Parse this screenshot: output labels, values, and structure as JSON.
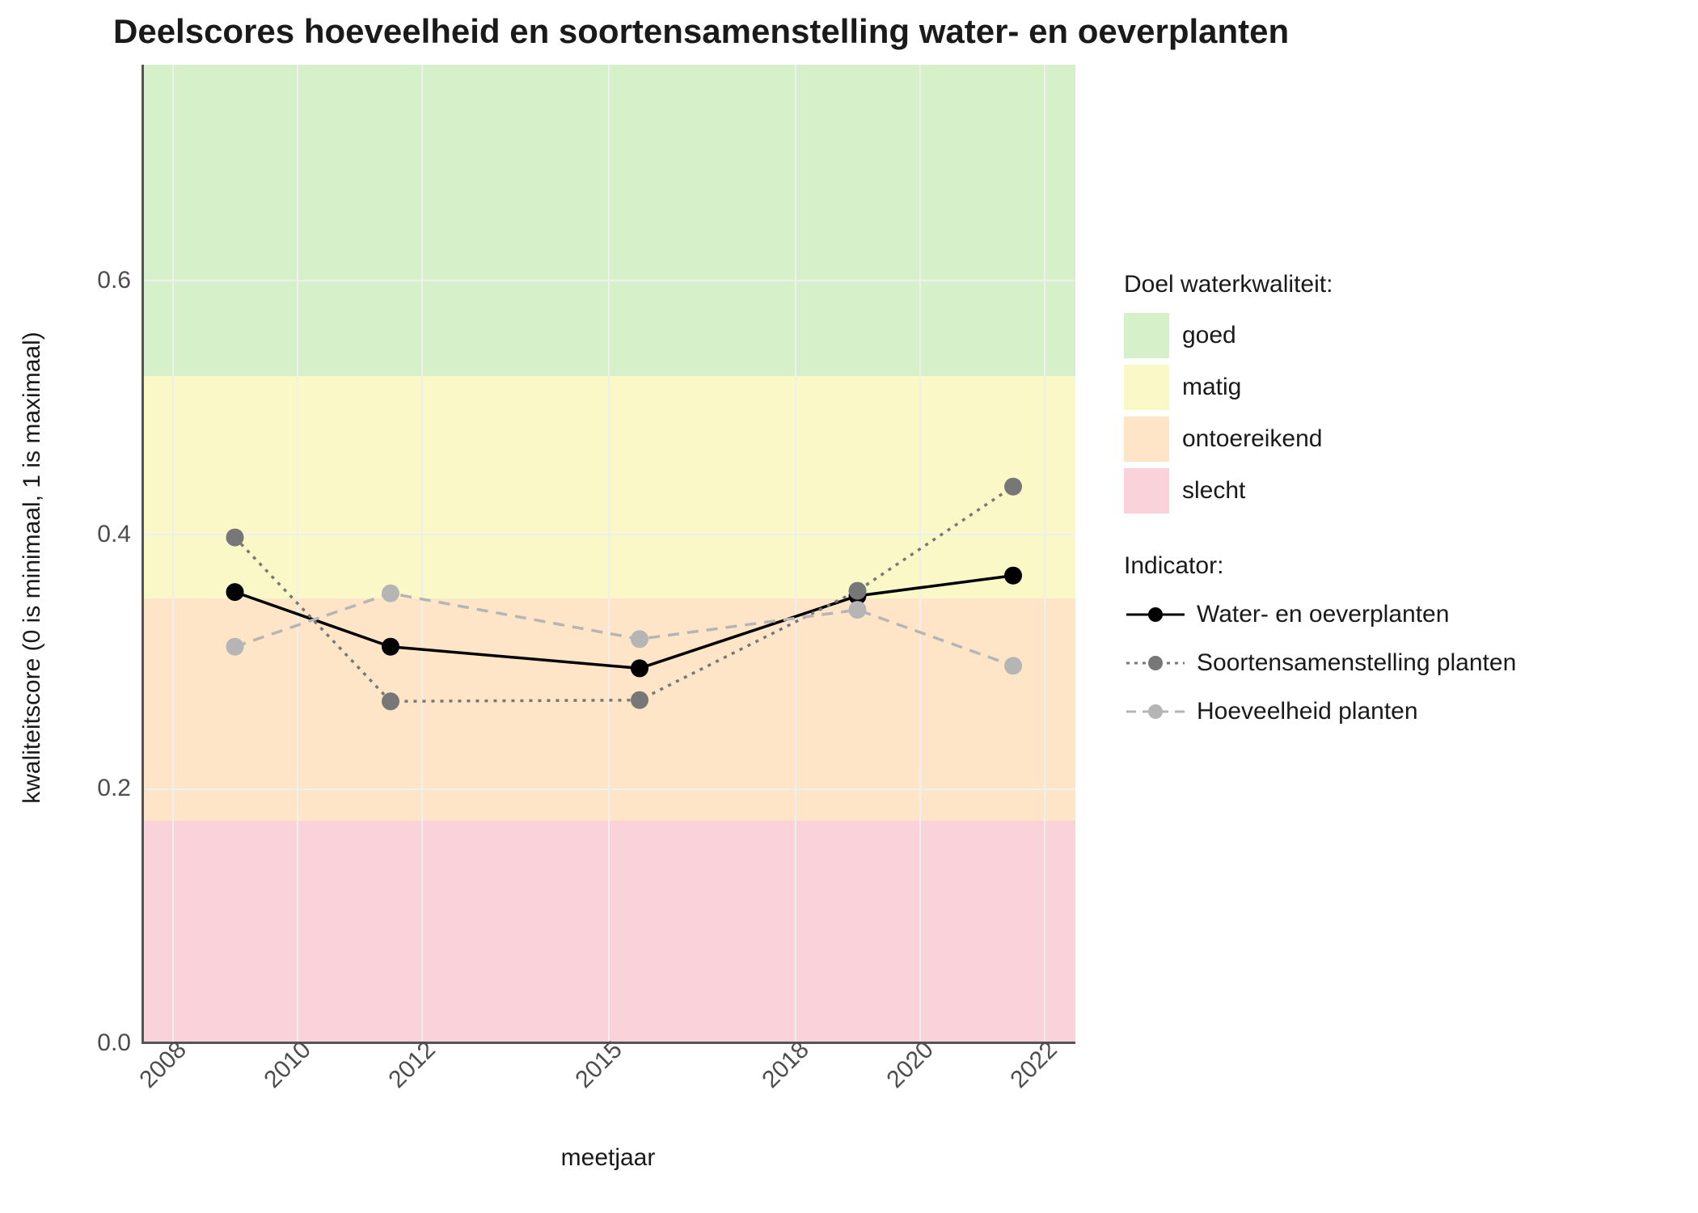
{
  "chart_data": {
    "type": "line",
    "title": "Deelscores hoeveelheid en soortensamenstelling water- en oeverplanten",
    "xlabel": "meetjaar",
    "ylabel": "kwaliteitscore (0 is minimaal, 1 is maximaal)",
    "x_ticks": [
      2008,
      2010,
      2012,
      2015,
      2018,
      2020,
      2022
    ],
    "y_ticks": [
      0.0,
      0.2,
      0.4,
      0.6
    ],
    "xlim": [
      2007.5,
      2022.5
    ],
    "ylim": [
      0.0,
      0.77
    ],
    "bands": [
      {
        "name": "goed",
        "from": 0.525,
        "to": 0.77,
        "color": "#d6f0c9"
      },
      {
        "name": "matig",
        "from": 0.35,
        "to": 0.525,
        "color": "#fbf8c7"
      },
      {
        "name": "ontoereikend",
        "from": 0.175,
        "to": 0.35,
        "color": "#fee5c7"
      },
      {
        "name": "slecht",
        "from": 0.0,
        "to": 0.175,
        "color": "#f9d2da"
      }
    ],
    "series": [
      {
        "name": "Water- en oeverplanten",
        "color": "#000000",
        "dash": "solid",
        "x": [
          2009,
          2011.5,
          2015.5,
          2019,
          2021.5
        ],
        "y": [
          0.355,
          0.312,
          0.295,
          0.352,
          0.368
        ]
      },
      {
        "name": "Soortensamenstelling planten",
        "color": "#777777",
        "dash": "dotted",
        "x": [
          2009,
          2011.5,
          2015.5,
          2019,
          2021.5
        ],
        "y": [
          0.398,
          0.269,
          0.27,
          0.356,
          0.438
        ]
      },
      {
        "name": "Hoeveelheid planten",
        "color": "#b5b5b5",
        "dash": "dashed",
        "x": [
          2009,
          2011.5,
          2015.5,
          2019,
          2021.5
        ],
        "y": [
          0.312,
          0.354,
          0.318,
          0.341,
          0.297
        ]
      }
    ],
    "legend_quality_title": "Doel waterkwaliteit:",
    "legend_indicator_title": "Indicator:",
    "legend_quality": [
      {
        "label": "goed",
        "color": "#d6f0c9"
      },
      {
        "label": "matig",
        "color": "#fbf8c7"
      },
      {
        "label": "ontoereikend",
        "color": "#fee5c7"
      },
      {
        "label": "slecht",
        "color": "#f9d2da"
      }
    ]
  }
}
